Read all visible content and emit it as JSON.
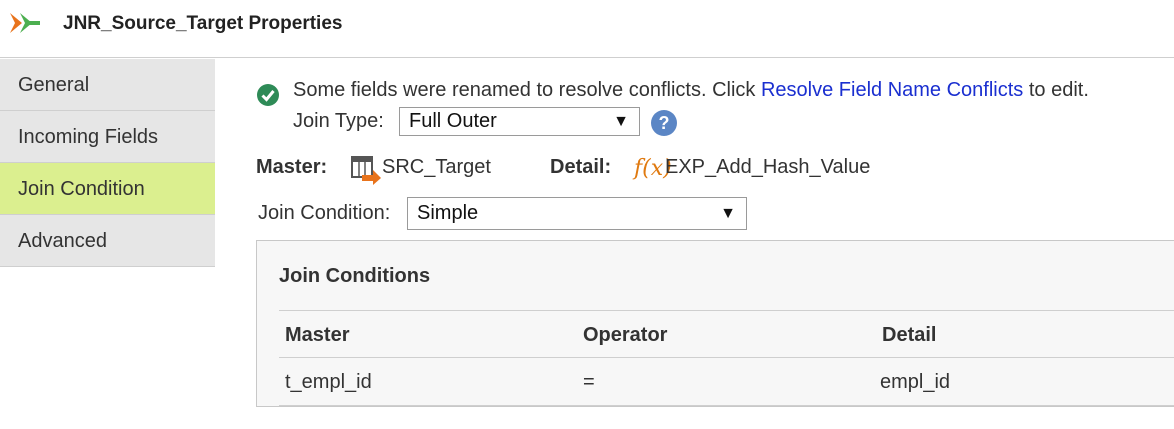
{
  "header": {
    "title": "JNR_Source_Target Properties",
    "icon": "joiner-icon",
    "icon_colors": [
      "#e8731c",
      "#4caf50"
    ]
  },
  "sidebar": {
    "items": [
      {
        "label": "General",
        "active": false
      },
      {
        "label": "Incoming Fields",
        "active": false
      },
      {
        "label": "Join Condition",
        "active": true
      },
      {
        "label": "Advanced",
        "active": false
      }
    ],
    "active_color": "#dbef8f"
  },
  "message": {
    "icon": "check-circle-icon",
    "text_before": "Some fields were renamed to resolve conflicts. Click ",
    "link": "Resolve Field Name Conflicts",
    "text_after": " to edit."
  },
  "join_type": {
    "label": "Join Type:",
    "value": "Full Outer"
  },
  "master": {
    "label": "Master:",
    "icon": "source-table-icon",
    "name": "SRC_Target"
  },
  "detail": {
    "label": "Detail:",
    "icon": "expression-fx-icon",
    "icon_text": "f(x)",
    "name": "EXP_Add_Hash_Value"
  },
  "join_condition": {
    "label": "Join Condition:",
    "value": "Simple"
  },
  "conditions_panel": {
    "title": "Join Conditions",
    "columns": [
      "Master",
      "Operator",
      "Detail"
    ],
    "rows": [
      [
        "t_empl_id",
        "=",
        "empl_id"
      ]
    ]
  },
  "colors": {
    "link": "#1a2fd0",
    "success": "#2e8b57",
    "help": "#5b86c5"
  }
}
